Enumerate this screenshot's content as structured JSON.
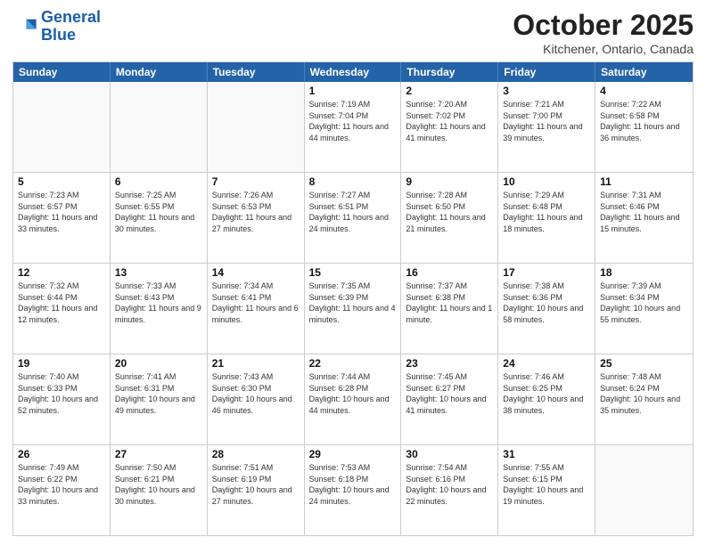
{
  "header": {
    "logo_line1": "General",
    "logo_line2": "Blue",
    "month_title": "October 2025",
    "location": "Kitchener, Ontario, Canada"
  },
  "weekdays": [
    "Sunday",
    "Monday",
    "Tuesday",
    "Wednesday",
    "Thursday",
    "Friday",
    "Saturday"
  ],
  "rows": [
    [
      {
        "day": "",
        "sunrise": "",
        "sunset": "",
        "daylight": ""
      },
      {
        "day": "",
        "sunrise": "",
        "sunset": "",
        "daylight": ""
      },
      {
        "day": "",
        "sunrise": "",
        "sunset": "",
        "daylight": ""
      },
      {
        "day": "1",
        "sunrise": "7:19 AM",
        "sunset": "7:04 PM",
        "daylight": "11 hours and 44 minutes."
      },
      {
        "day": "2",
        "sunrise": "7:20 AM",
        "sunset": "7:02 PM",
        "daylight": "11 hours and 41 minutes."
      },
      {
        "day": "3",
        "sunrise": "7:21 AM",
        "sunset": "7:00 PM",
        "daylight": "11 hours and 39 minutes."
      },
      {
        "day": "4",
        "sunrise": "7:22 AM",
        "sunset": "6:58 PM",
        "daylight": "11 hours and 36 minutes."
      }
    ],
    [
      {
        "day": "5",
        "sunrise": "7:23 AM",
        "sunset": "6:57 PM",
        "daylight": "11 hours and 33 minutes."
      },
      {
        "day": "6",
        "sunrise": "7:25 AM",
        "sunset": "6:55 PM",
        "daylight": "11 hours and 30 minutes."
      },
      {
        "day": "7",
        "sunrise": "7:26 AM",
        "sunset": "6:53 PM",
        "daylight": "11 hours and 27 minutes."
      },
      {
        "day": "8",
        "sunrise": "7:27 AM",
        "sunset": "6:51 PM",
        "daylight": "11 hours and 24 minutes."
      },
      {
        "day": "9",
        "sunrise": "7:28 AM",
        "sunset": "6:50 PM",
        "daylight": "11 hours and 21 minutes."
      },
      {
        "day": "10",
        "sunrise": "7:29 AM",
        "sunset": "6:48 PM",
        "daylight": "11 hours and 18 minutes."
      },
      {
        "day": "11",
        "sunrise": "7:31 AM",
        "sunset": "6:46 PM",
        "daylight": "11 hours and 15 minutes."
      }
    ],
    [
      {
        "day": "12",
        "sunrise": "7:32 AM",
        "sunset": "6:44 PM",
        "daylight": "11 hours and 12 minutes."
      },
      {
        "day": "13",
        "sunrise": "7:33 AM",
        "sunset": "6:43 PM",
        "daylight": "11 hours and 9 minutes."
      },
      {
        "day": "14",
        "sunrise": "7:34 AM",
        "sunset": "6:41 PM",
        "daylight": "11 hours and 6 minutes."
      },
      {
        "day": "15",
        "sunrise": "7:35 AM",
        "sunset": "6:39 PM",
        "daylight": "11 hours and 4 minutes."
      },
      {
        "day": "16",
        "sunrise": "7:37 AM",
        "sunset": "6:38 PM",
        "daylight": "11 hours and 1 minute."
      },
      {
        "day": "17",
        "sunrise": "7:38 AM",
        "sunset": "6:36 PM",
        "daylight": "10 hours and 58 minutes."
      },
      {
        "day": "18",
        "sunrise": "7:39 AM",
        "sunset": "6:34 PM",
        "daylight": "10 hours and 55 minutes."
      }
    ],
    [
      {
        "day": "19",
        "sunrise": "7:40 AM",
        "sunset": "6:33 PM",
        "daylight": "10 hours and 52 minutes."
      },
      {
        "day": "20",
        "sunrise": "7:41 AM",
        "sunset": "6:31 PM",
        "daylight": "10 hours and 49 minutes."
      },
      {
        "day": "21",
        "sunrise": "7:43 AM",
        "sunset": "6:30 PM",
        "daylight": "10 hours and 46 minutes."
      },
      {
        "day": "22",
        "sunrise": "7:44 AM",
        "sunset": "6:28 PM",
        "daylight": "10 hours and 44 minutes."
      },
      {
        "day": "23",
        "sunrise": "7:45 AM",
        "sunset": "6:27 PM",
        "daylight": "10 hours and 41 minutes."
      },
      {
        "day": "24",
        "sunrise": "7:46 AM",
        "sunset": "6:25 PM",
        "daylight": "10 hours and 38 minutes."
      },
      {
        "day": "25",
        "sunrise": "7:48 AM",
        "sunset": "6:24 PM",
        "daylight": "10 hours and 35 minutes."
      }
    ],
    [
      {
        "day": "26",
        "sunrise": "7:49 AM",
        "sunset": "6:22 PM",
        "daylight": "10 hours and 33 minutes."
      },
      {
        "day": "27",
        "sunrise": "7:50 AM",
        "sunset": "6:21 PM",
        "daylight": "10 hours and 30 minutes."
      },
      {
        "day": "28",
        "sunrise": "7:51 AM",
        "sunset": "6:19 PM",
        "daylight": "10 hours and 27 minutes."
      },
      {
        "day": "29",
        "sunrise": "7:53 AM",
        "sunset": "6:18 PM",
        "daylight": "10 hours and 24 minutes."
      },
      {
        "day": "30",
        "sunrise": "7:54 AM",
        "sunset": "6:16 PM",
        "daylight": "10 hours and 22 minutes."
      },
      {
        "day": "31",
        "sunrise": "7:55 AM",
        "sunset": "6:15 PM",
        "daylight": "10 hours and 19 minutes."
      },
      {
        "day": "",
        "sunrise": "",
        "sunset": "",
        "daylight": ""
      }
    ]
  ]
}
